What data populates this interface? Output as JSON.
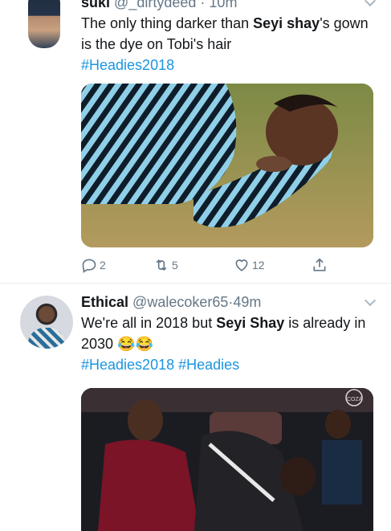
{
  "tweets": [
    {
      "name": "suki",
      "handle": "@_dirtydeed",
      "sep": "·",
      "time": "10m",
      "text_parts": [
        "The only thing darker than ",
        "Seyi shay",
        "'s gown is the dye on Tobi's hair"
      ],
      "hashtags": [
        "#Headies2018"
      ],
      "actions": {
        "reply": "2",
        "retweet": "5",
        "like": "12"
      }
    },
    {
      "name": "Ethical",
      "handle": "@walecoker65",
      "sep": "·",
      "time": "49m",
      "text_parts": [
        "We're all in 2018 but ",
        "Seyi Shay",
        " is already in 2030 ",
        "😂😂"
      ],
      "hashtags": [
        "#Headies2018",
        "#Headies"
      ]
    }
  ],
  "media_watermark": "COZA",
  "colors": {
    "link": "#1b95e0",
    "muted": "#657786",
    "divider": "#e6ecf0"
  },
  "icons": [
    "reply-icon",
    "retweet-icon",
    "like-icon",
    "share-icon",
    "chevron-down-icon"
  ]
}
